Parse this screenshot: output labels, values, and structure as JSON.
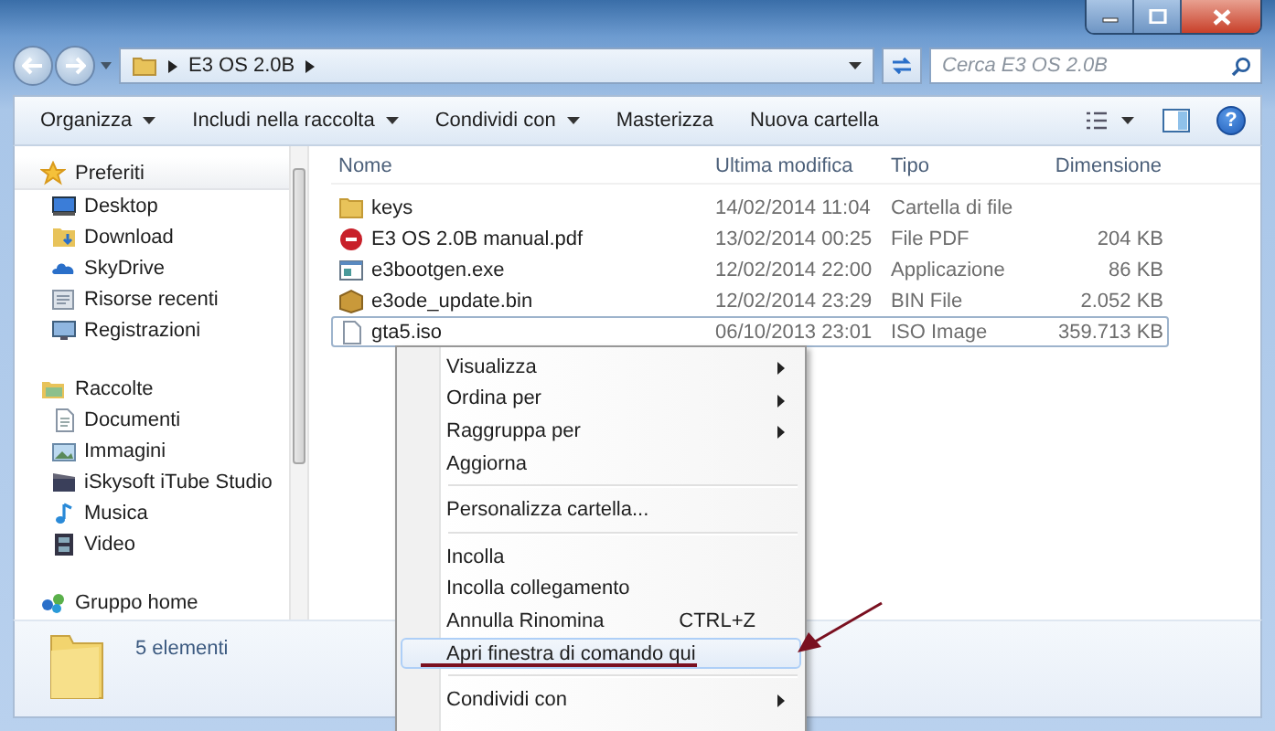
{
  "address_bar": {
    "path": [
      "E3 OS 2.0B"
    ]
  },
  "search": {
    "placeholder": "Cerca E3 OS 2.0B"
  },
  "toolbar": [
    {
      "label": "Organizza",
      "dropdown": true
    },
    {
      "label": "Includi nella raccolta",
      "dropdown": true
    },
    {
      "label": "Condividi con",
      "dropdown": true
    },
    {
      "label": "Masterizza",
      "dropdown": false
    },
    {
      "label": "Nuova cartella",
      "dropdown": false
    }
  ],
  "sidebar": {
    "groups": [
      {
        "label": "Preferiti",
        "kind": "star",
        "selected": true,
        "items": [
          {
            "label": "Desktop",
            "kind": "desktop"
          },
          {
            "label": "Download",
            "kind": "download"
          },
          {
            "label": "SkyDrive",
            "kind": "cloud"
          },
          {
            "label": "Risorse recenti",
            "kind": "recent"
          },
          {
            "label": "Registrazioni",
            "kind": "monitor"
          }
        ]
      },
      {
        "label": "Raccolte",
        "kind": "library",
        "selected": false,
        "items": [
          {
            "label": "Documenti",
            "kind": "document"
          },
          {
            "label": "Immagini",
            "kind": "image"
          },
          {
            "label": "iSkysoft iTube Studio",
            "kind": "clapper"
          },
          {
            "label": "Musica",
            "kind": "music"
          },
          {
            "label": "Video",
            "kind": "film"
          }
        ]
      },
      {
        "label": "Gruppo home",
        "kind": "homegroup",
        "selected": false
      }
    ]
  },
  "table": {
    "columns": [
      "Nome",
      "Ultima modifica",
      "Tipo",
      "Dimensione"
    ],
    "rows": [
      {
        "name": "keys",
        "modified": "14/02/2014 11:04",
        "type": "Cartella di file",
        "kind": "folder",
        "selected": false
      },
      {
        "name": "E3 OS 2.0B manual.pdf",
        "modified": "13/02/2014 00:25",
        "type": "File PDF",
        "size": "204 KB",
        "kind": "pdf",
        "selected": false
      },
      {
        "name": "e3bootgen.exe",
        "modified": "12/02/2014 22:00",
        "type": "Applicazione",
        "size": "86 KB",
        "kind": "exe",
        "selected": false
      },
      {
        "name": "e3ode_update.bin",
        "modified": "12/02/2014 23:29",
        "type": "BIN File",
        "size": "2.052 KB",
        "kind": "package",
        "selected": false
      },
      {
        "name": "gta5.iso",
        "modified": "06/10/2013 23:01",
        "type": "ISO Image",
        "size": "359.713 KB",
        "kind": "file",
        "selected": true
      }
    ]
  },
  "status_bar": {
    "count": "5 elementi"
  },
  "context_menu": {
    "items": [
      {
        "kind": "item",
        "label": "Visualizza",
        "submenu": true,
        "highlighted": false
      },
      {
        "kind": "item",
        "label": "Ordina per",
        "submenu": true,
        "highlighted": false
      },
      {
        "kind": "item",
        "label": "Raggruppa per",
        "submenu": true,
        "highlighted": false
      },
      {
        "kind": "item",
        "label": "Aggiorna",
        "submenu": false,
        "highlighted": false
      },
      {
        "kind": "separator"
      },
      {
        "kind": "item",
        "label": "Personalizza cartella...",
        "submenu": false,
        "highlighted": false
      },
      {
        "kind": "separator"
      },
      {
        "kind": "item",
        "label": "Incolla",
        "submenu": false,
        "highlighted": false
      },
      {
        "kind": "item",
        "label": "Incolla collegamento",
        "submenu": false,
        "highlighted": false
      },
      {
        "kind": "item",
        "label": "Annulla Rinomina",
        "shortcut": "CTRL+Z",
        "submenu": false,
        "highlighted": false
      },
      {
        "kind": "item",
        "label": "Apri finestra di comando qui",
        "submenu": false,
        "highlighted": true
      },
      {
        "kind": "separator"
      },
      {
        "kind": "item",
        "label": "Condividi con",
        "submenu": true,
        "highlighted": false
      }
    ]
  },
  "help_button": {
    "label": "?"
  }
}
